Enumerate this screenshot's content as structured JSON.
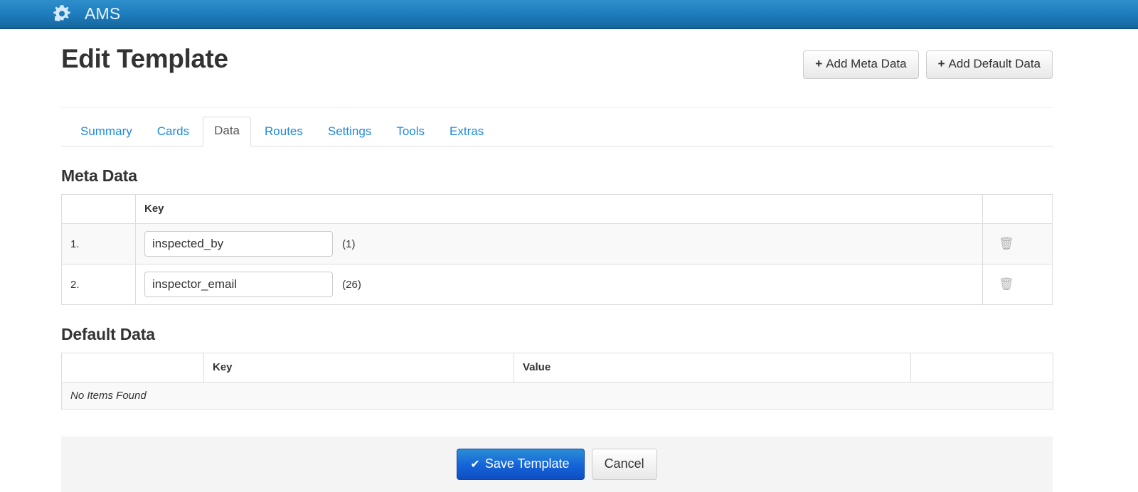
{
  "navbar": {
    "brand": "AMS",
    "logo_icon": "gear-icon",
    "background_start": "#2e8fcc",
    "background_end": "#15679f"
  },
  "header": {
    "title": "Edit Template",
    "actions": [
      {
        "label": "Add Meta Data",
        "icon": "plus-icon",
        "name": "add-meta-data-button"
      },
      {
        "label": "Add Default Data",
        "icon": "plus-icon",
        "name": "add-default-data-button"
      }
    ]
  },
  "tabs": {
    "active": "Data",
    "active_color": "#555555",
    "link_color": "#1c8ade",
    "items": [
      {
        "label": "Summary",
        "active": false
      },
      {
        "label": "Cards",
        "active": false
      },
      {
        "label": "Data",
        "active": true
      },
      {
        "label": "Routes",
        "active": false
      },
      {
        "label": "Settings",
        "active": false
      },
      {
        "label": "Tools",
        "active": false
      },
      {
        "label": "Extras",
        "active": false
      }
    ]
  },
  "meta_data": {
    "heading": "Meta Data",
    "columns": [
      "",
      "Key",
      ""
    ],
    "rows": [
      {
        "index": "1.",
        "key_value": "inspected_by",
        "count": "(1)",
        "delete_icon": "trash-icon"
      },
      {
        "index": "2.",
        "key_value": "inspector_email",
        "count": "(26)",
        "delete_icon": "trash-icon"
      }
    ]
  },
  "default_data": {
    "heading": "Default Data",
    "columns": [
      "",
      "Key",
      "Value",
      ""
    ],
    "empty_message": "No Items Found",
    "rows": []
  },
  "footer": {
    "save_label": "Save Template",
    "save_icon": "check-icon",
    "cancel_label": "Cancel",
    "primary_color": "#1565d8"
  }
}
